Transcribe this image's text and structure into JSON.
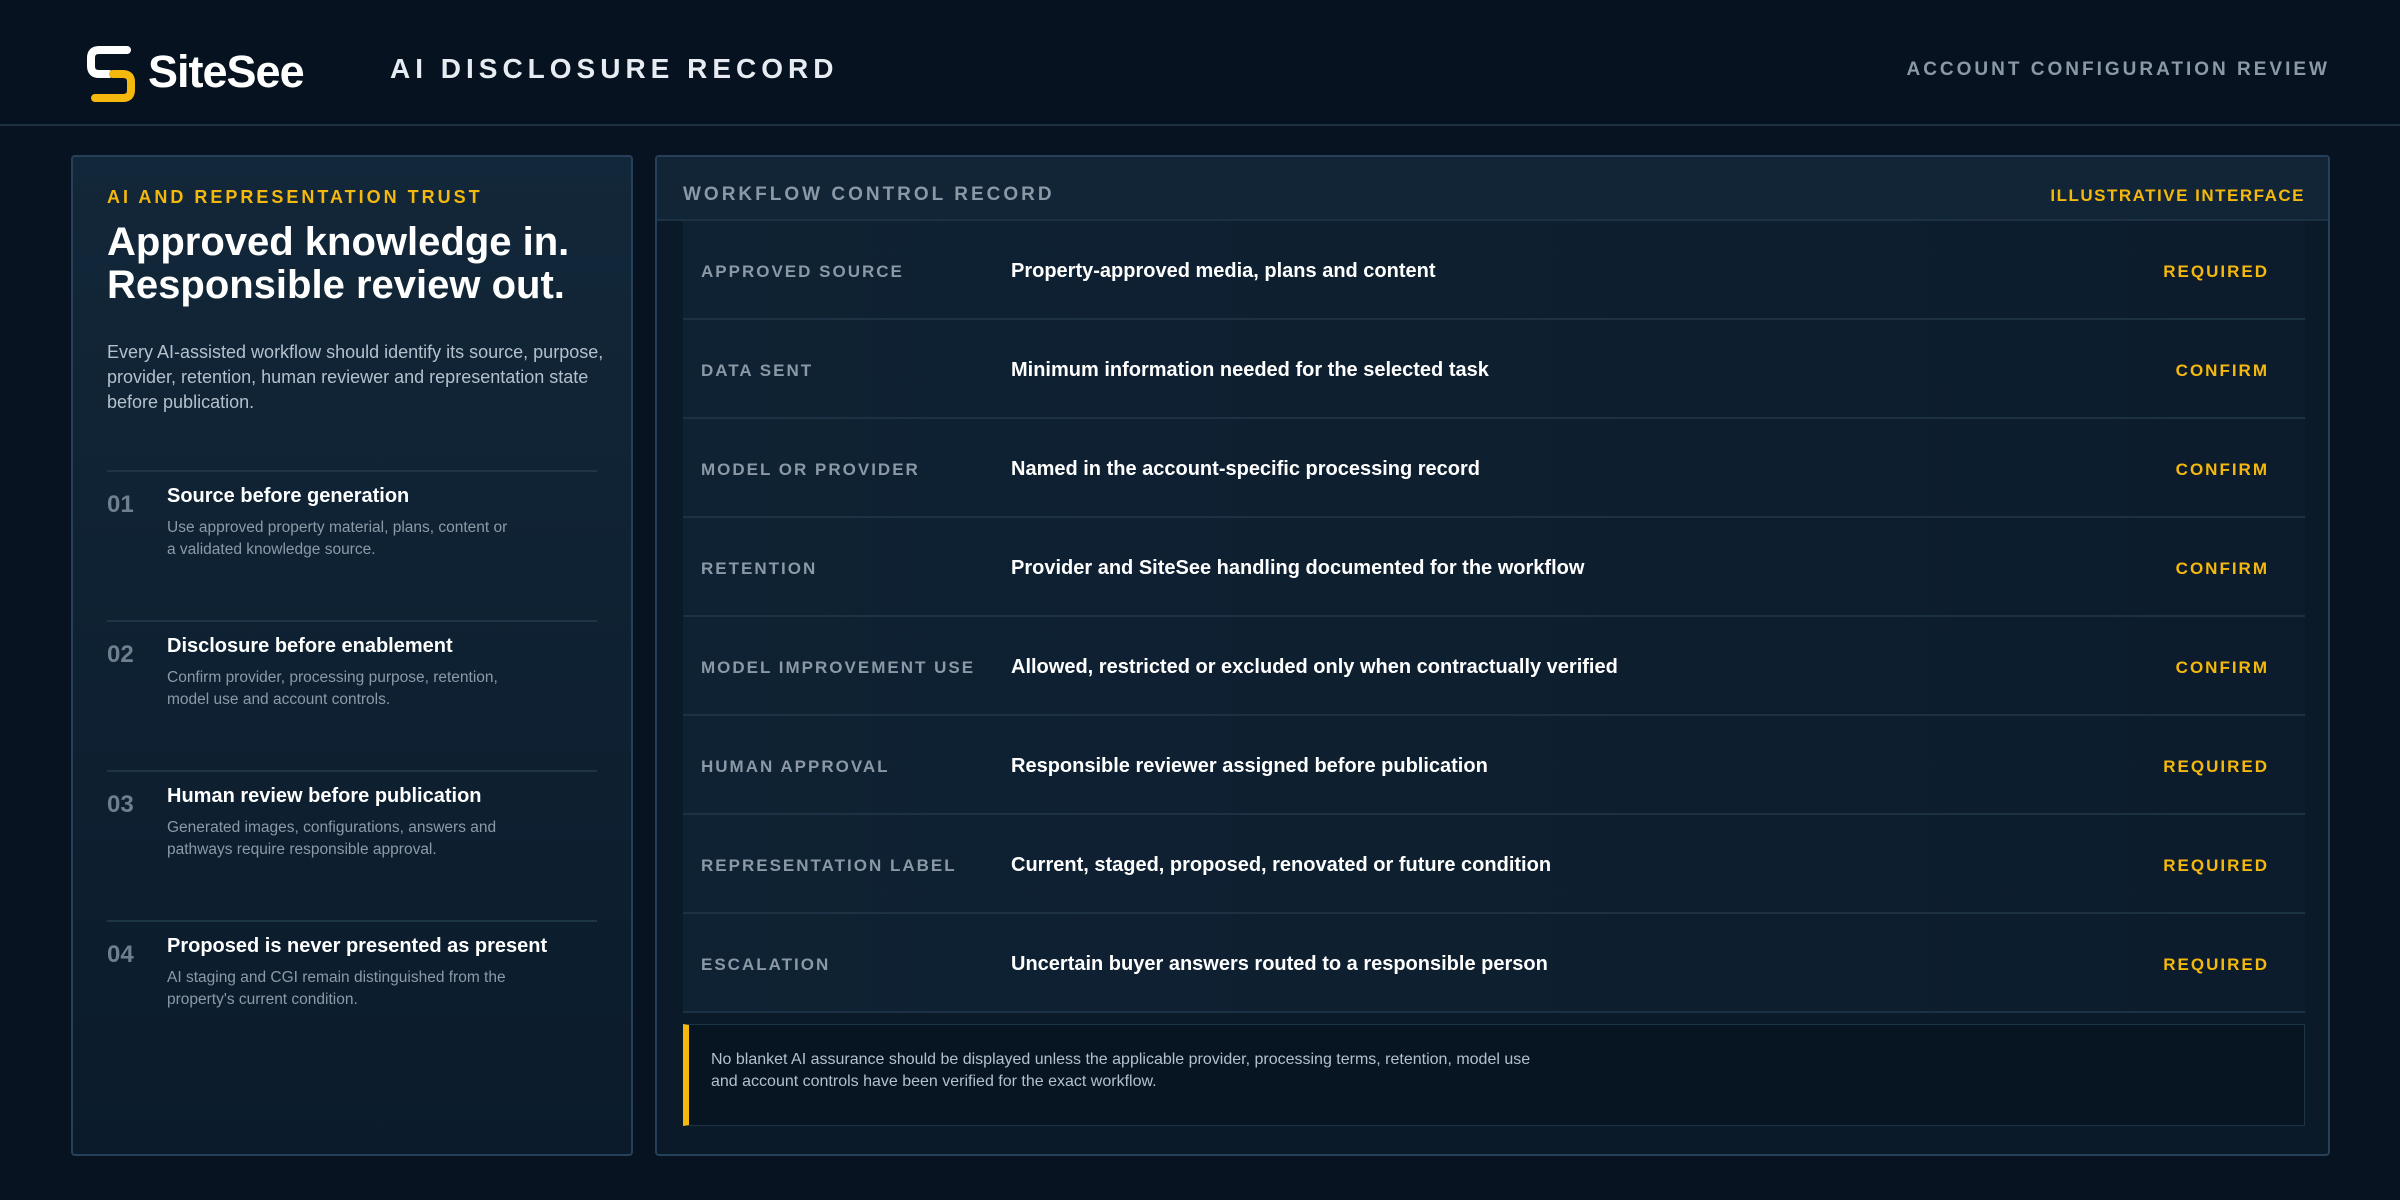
{
  "header": {
    "brand": "SiteSee",
    "title": "AI DISCLOSURE RECORD",
    "right_label": "ACCOUNT CONFIGURATION REVIEW"
  },
  "left_panel": {
    "eyebrow": "AI AND REPRESENTATION TRUST",
    "headline_line1": "Approved knowledge in.",
    "headline_line2": "Responsible review out.",
    "intro": "Every AI-assisted workflow should identify its source, purpose, provider, retention, human reviewer and representation state before publication.",
    "steps": [
      {
        "num": "01",
        "title": "Source before generation",
        "desc": "Use approved property material, plans, content or a validated knowledge source."
      },
      {
        "num": "02",
        "title": "Disclosure before enablement",
        "desc": "Confirm provider, processing purpose, retention, model use and account controls."
      },
      {
        "num": "03",
        "title": "Human review before publication",
        "desc": "Generated images, configurations, answers and pathways require responsible approval."
      },
      {
        "num": "04",
        "title": "Proposed is never presented as present",
        "desc": "AI staging and CGI remain distinguished from the property's current condition."
      }
    ]
  },
  "right_panel": {
    "title": "WORKFLOW CONTROL RECORD",
    "tag": "ILLUSTRATIVE INTERFACE",
    "rows": [
      {
        "label": "APPROVED SOURCE",
        "value": "Property-approved media, plans and content",
        "status": "REQUIRED"
      },
      {
        "label": "DATA SENT",
        "value": "Minimum information needed for the selected task",
        "status": "CONFIRM"
      },
      {
        "label": "MODEL OR PROVIDER",
        "value": "Named in the account-specific processing record",
        "status": "CONFIRM"
      },
      {
        "label": "RETENTION",
        "value": "Provider and SiteSee handling documented for the workflow",
        "status": "CONFIRM"
      },
      {
        "label": "MODEL IMPROVEMENT USE",
        "value": "Allowed, restricted or excluded only when contractually verified",
        "status": "CONFIRM"
      },
      {
        "label": "HUMAN APPROVAL",
        "value": "Responsible reviewer assigned before publication",
        "status": "REQUIRED"
      },
      {
        "label": "REPRESENTATION LABEL",
        "value": "Current, staged, proposed, renovated or future condition",
        "status": "REQUIRED"
      },
      {
        "label": "ESCALATION",
        "value": "Uncertain buyer answers routed to a responsible person",
        "status": "REQUIRED"
      }
    ],
    "note": "No blanket AI assurance should be displayed unless the applicable provider, processing terms, retention, model use and account controls have been verified for the exact workflow."
  },
  "colors": {
    "accent": "#f5b80c",
    "background": "#071320",
    "muted_label": "#8b98a6"
  },
  "icons": {
    "brand": "sitesee-logo-icon"
  }
}
